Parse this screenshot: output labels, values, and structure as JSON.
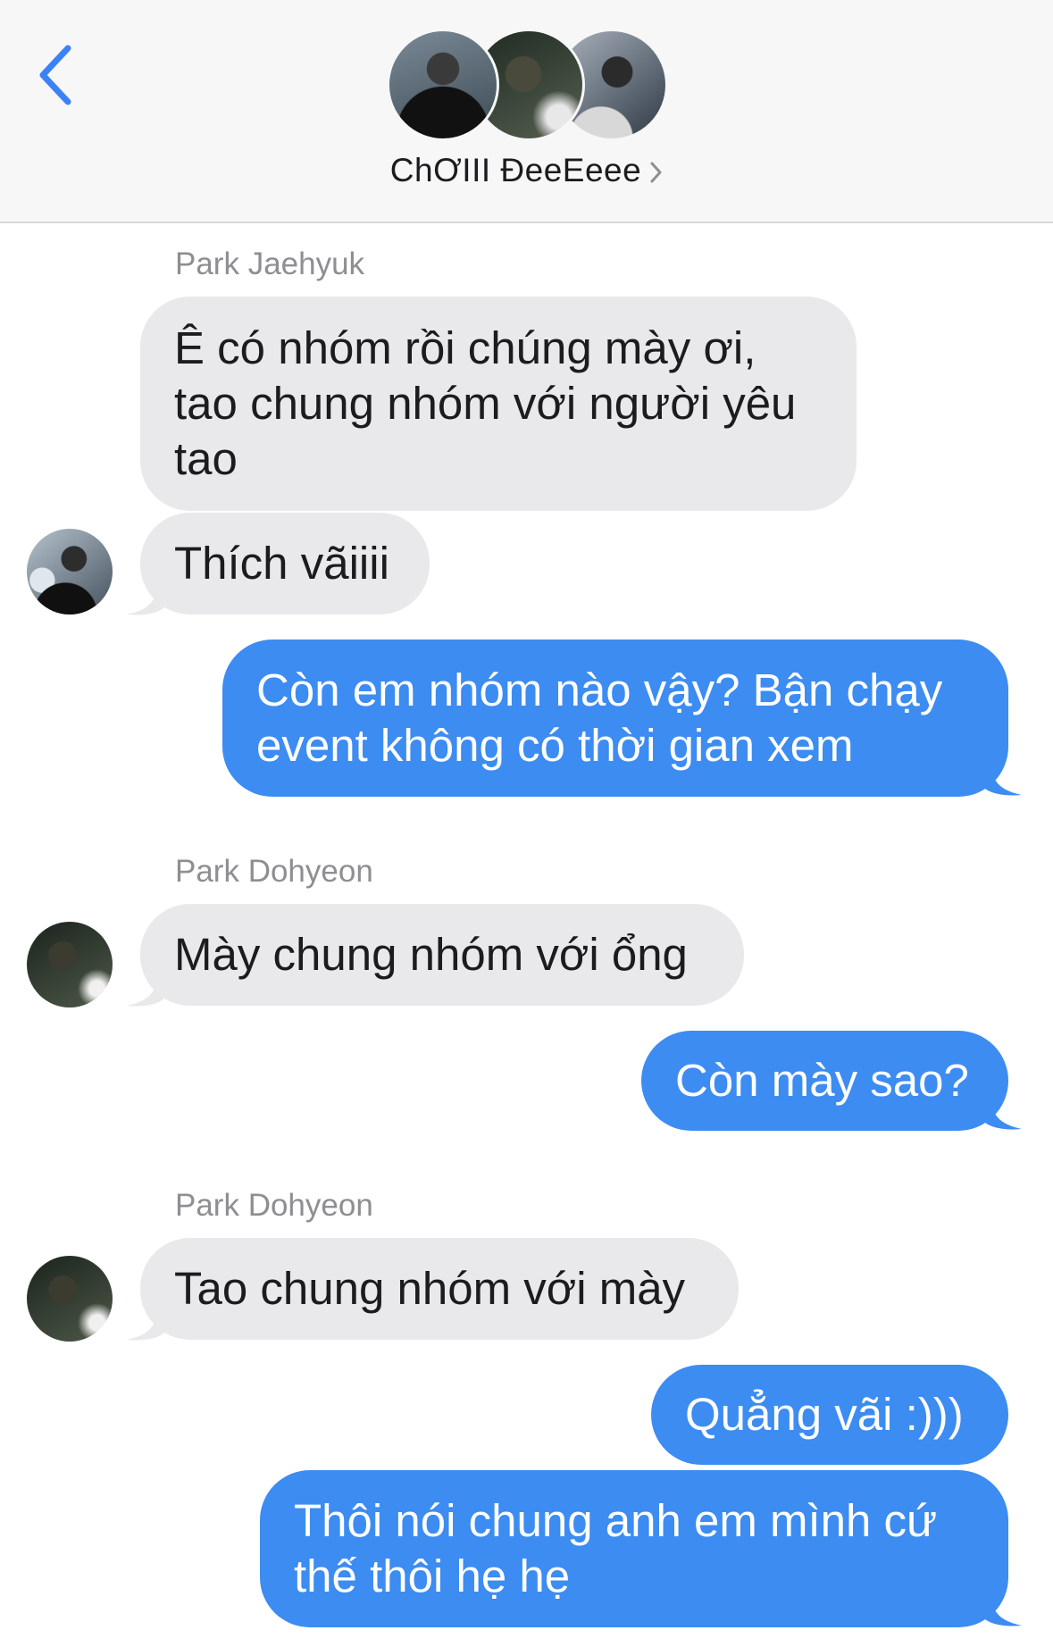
{
  "header": {
    "title": "ChƠIII ĐeeEeee",
    "avatars": [
      "group-member-1-avatar",
      "group-member-2-avatar",
      "group-member-3-avatar"
    ]
  },
  "colors": {
    "sent_bubble": "#3c8cf2",
    "received_bubble": "#e9e9eb",
    "accent_back": "#3b82f6"
  },
  "messages": [
    {
      "sender": "Park Jaehyuk",
      "direction": "received",
      "text": "Ê có nhóm rồi chúng mày ơi,\ntao chung nhóm với người yêu\ntao"
    },
    {
      "sender": "",
      "direction": "received",
      "text": "Thích vãiiii"
    },
    {
      "sender": "",
      "direction": "sent",
      "text": "Còn em nhóm nào vậy? Bận chạy\nevent không có thời gian xem"
    },
    {
      "sender": "Park Dohyeon",
      "direction": "received",
      "text": "Mày chung nhóm với ổng"
    },
    {
      "sender": "",
      "direction": "sent",
      "text": "Còn mày sao?"
    },
    {
      "sender": "Park Dohyeon",
      "direction": "received",
      "text": "Tao chung nhóm với mày"
    },
    {
      "sender": "",
      "direction": "sent",
      "text": "Quẳng vãi :)))"
    },
    {
      "sender": "",
      "direction": "sent",
      "text": "Thôi nói chung anh em mình cứ\nthế thôi hẹ hẹ"
    }
  ]
}
